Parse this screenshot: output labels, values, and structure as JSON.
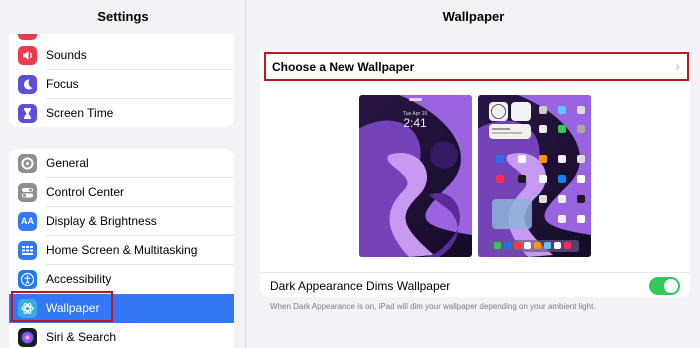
{
  "sidebar": {
    "title": "Settings",
    "group1": [
      {
        "label": "Sounds",
        "icon": "speaker-icon",
        "color": "#ef3a4d",
        "glyph": "🔊"
      },
      {
        "label": "Focus",
        "icon": "moon-icon",
        "color": "#5b4fd8",
        "glyph": "☾"
      },
      {
        "label": "Screen Time",
        "icon": "hourglass-icon",
        "color": "#5b4fd8",
        "glyph": "⧗"
      }
    ],
    "group2": [
      {
        "label": "General",
        "icon": "gear-icon",
        "color": "#8e8e93",
        "glyph": "⚙"
      },
      {
        "label": "Control Center",
        "icon": "toggles-icon",
        "color": "#8e8e93",
        "glyph": "☰"
      },
      {
        "label": "Display & Brightness",
        "icon": "text-size-icon",
        "color": "#3478f6",
        "glyph": "AA"
      },
      {
        "label": "Home Screen & Multitasking",
        "icon": "grid-icon",
        "color": "#3478f6",
        "glyph": "▦"
      },
      {
        "label": "Accessibility",
        "icon": "accessibility-icon",
        "color": "#1e7cf0",
        "glyph": "♿"
      },
      {
        "label": "Wallpaper",
        "icon": "flower-icon",
        "color": "#32ade6",
        "glyph": "✿",
        "selected": true
      },
      {
        "label": "Siri & Search",
        "icon": "siri-icon",
        "color": "#1c1c1e",
        "glyph": "◉"
      }
    ]
  },
  "main": {
    "title": "Wallpaper",
    "choose_label": "Choose a New Wallpaper",
    "lock_time": "2:41",
    "dark_label": "Dark Appearance Dims Wallpaper",
    "dark_enabled": true,
    "footnote": "When Dark Appearance is on, iPad will dim your wallpaper depending on your ambient light."
  },
  "colors": {
    "accent": "#3478f6",
    "toggle_on": "#34c759",
    "annotation_red": "#c0171f"
  }
}
